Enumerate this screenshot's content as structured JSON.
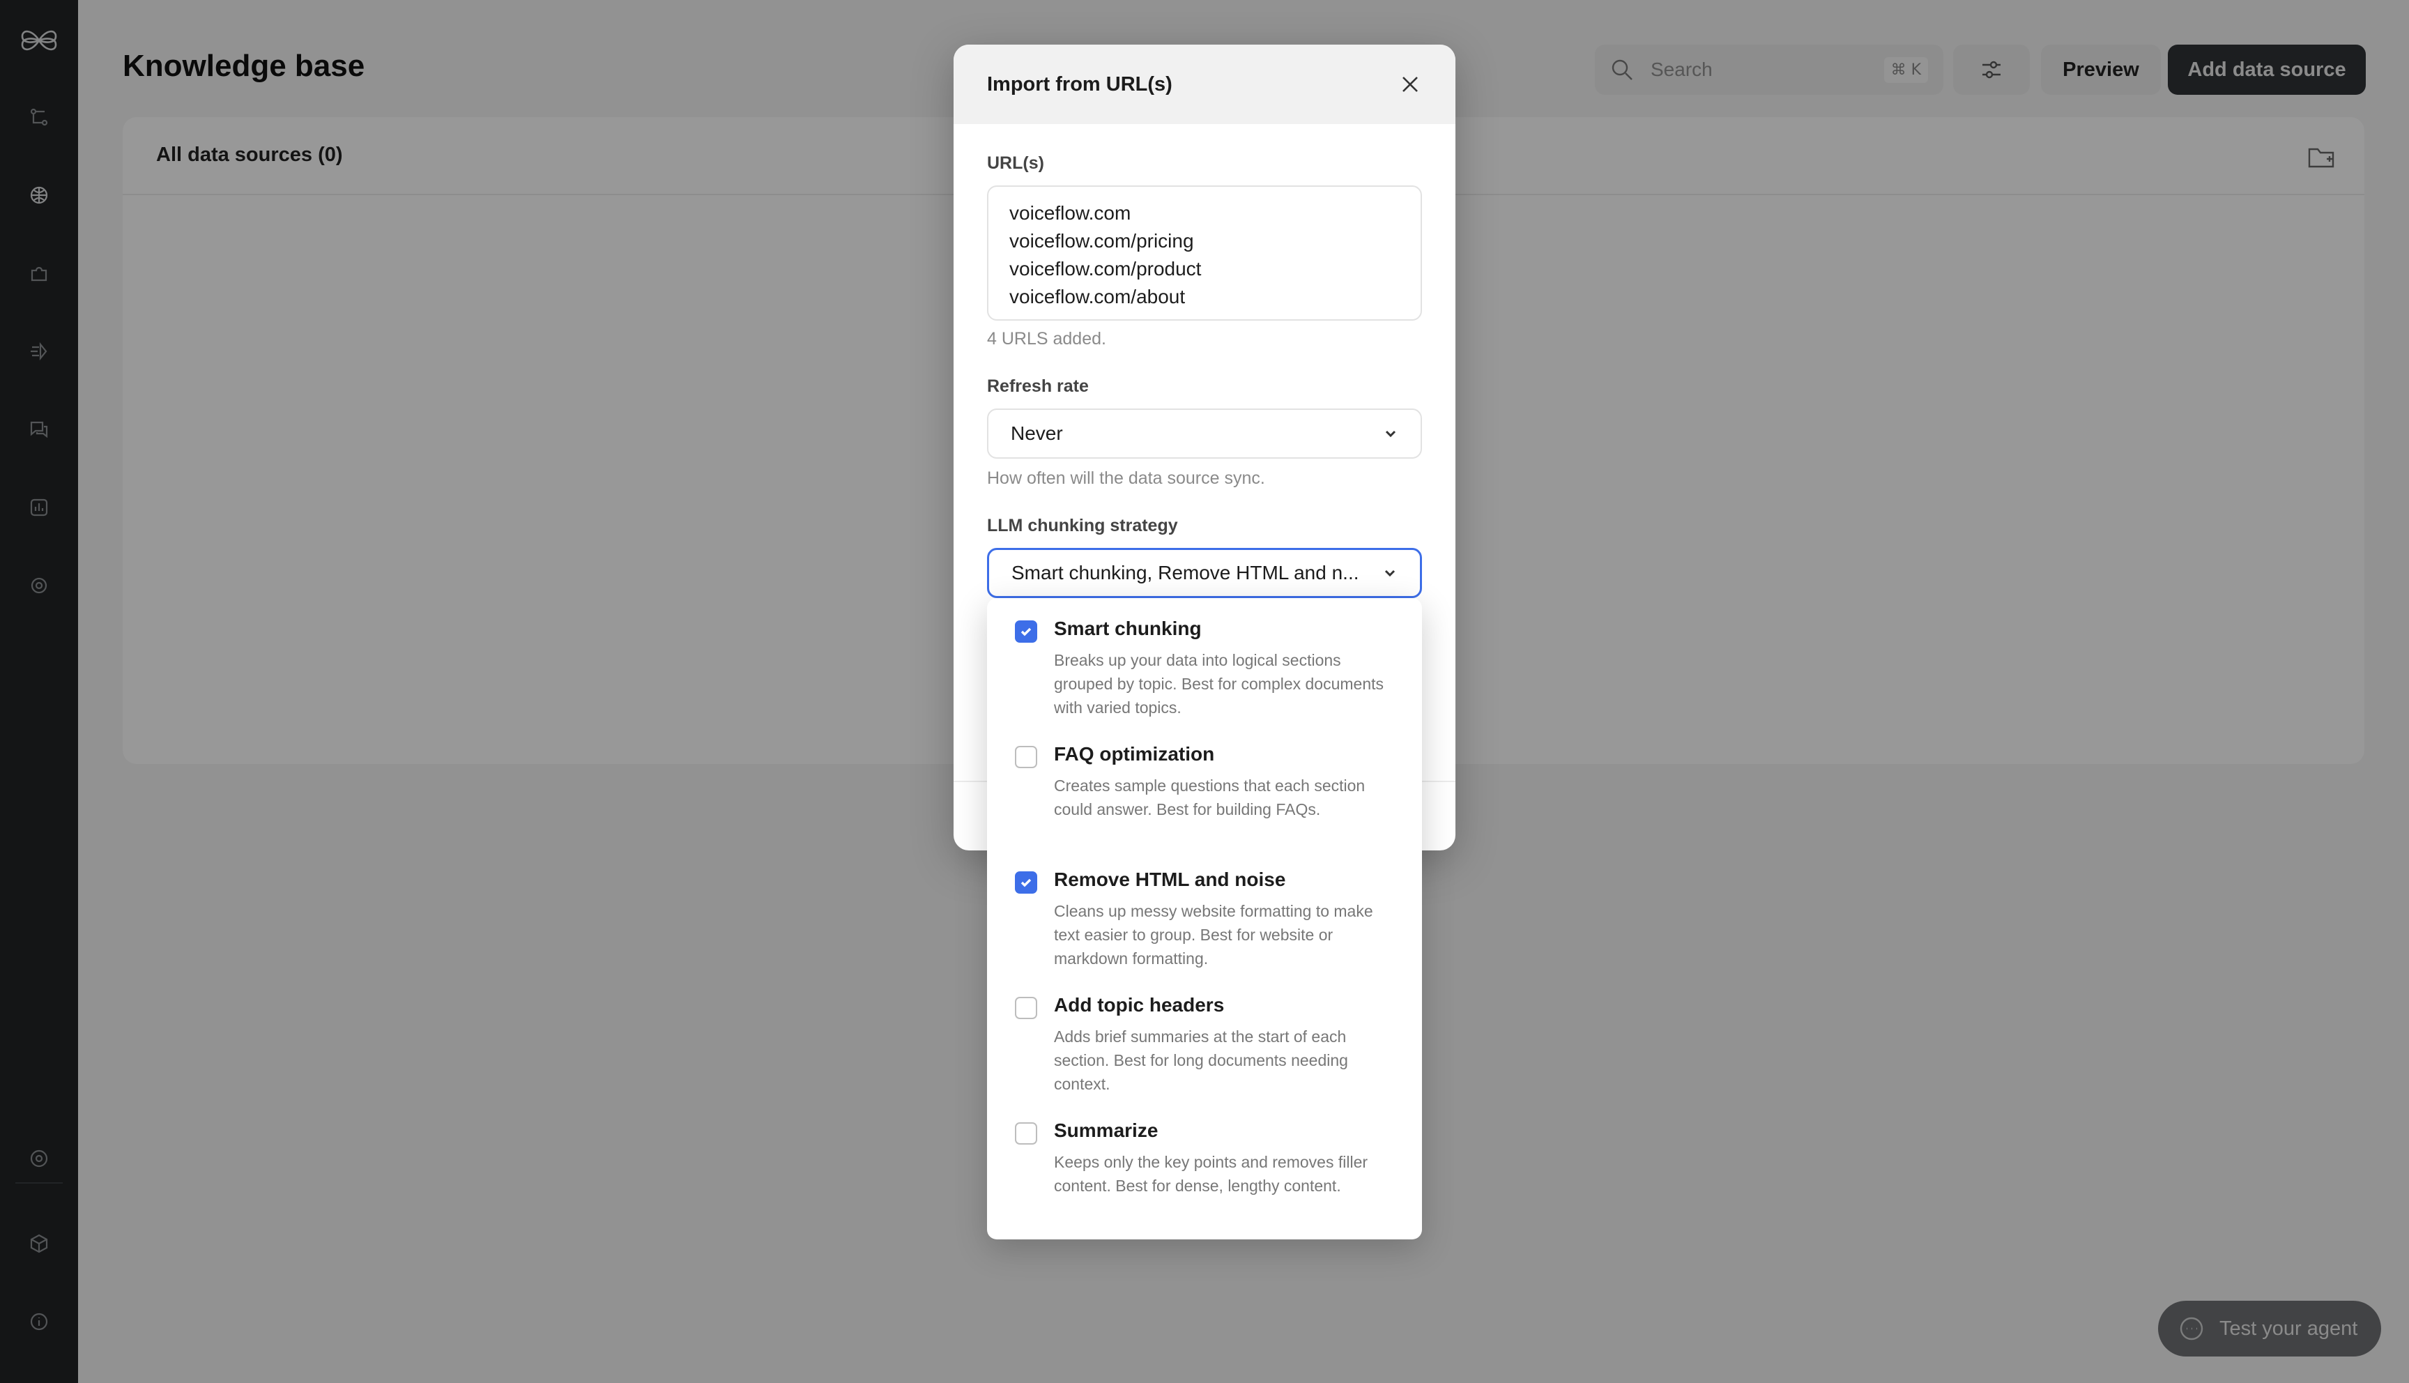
{
  "page": {
    "title": "Knowledge base",
    "search_placeholder": "Search",
    "search_shortcut": "⌘ K",
    "preview_label": "Preview",
    "add_source_label": "Add data source",
    "panel_title": "All data sources (0)",
    "test_agent_label": "Test your agent"
  },
  "sidebar": {
    "icons": [
      "logo-icon",
      "workflow-icon",
      "knowledge-icon",
      "puzzle-icon",
      "agent-icon",
      "conversations-icon",
      "analytics-icon",
      "settings-icon",
      "help-circle-icon",
      "cube-icon",
      "info-icon"
    ]
  },
  "modal": {
    "title": "Import from URL(s)",
    "urls_label": "URL(s)",
    "urls": [
      "voiceflow.com",
      "voiceflow.com/pricing",
      "voiceflow.com/product",
      "voiceflow.com/about"
    ],
    "urls_count_hint": "4 URLS added.",
    "refresh_label": "Refresh rate",
    "refresh_value": "Never",
    "refresh_hint": "How often will the data source sync.",
    "chunking_label": "LLM chunking strategy",
    "chunking_value": "Smart chunking, Remove HTML and n..."
  },
  "chunking_options": [
    {
      "label": "Smart chunking",
      "desc": "Breaks up your data into logical sections grouped by topic. Best for complex documents with varied topics.",
      "checked": true
    },
    {
      "label": "FAQ optimization",
      "desc": "Creates sample questions that each section could answer. Best for building FAQs.",
      "checked": false
    },
    {
      "label": "Remove HTML and noise",
      "desc": "Cleans up messy website formatting to make text easier to group. Best for website or markdown formatting.",
      "checked": true
    },
    {
      "label": "Add topic headers",
      "desc": "Adds brief summaries at the start of each section. Best for long documents needing context.",
      "checked": false
    },
    {
      "label": "Summarize",
      "desc": "Keeps only the key points and removes filler content. Best for dense, lengthy content.",
      "checked": false
    }
  ],
  "colors": {
    "accent": "#3d6ee8",
    "sidebar_bg": "#222426",
    "overlay": "rgba(0,0,0,0.40)"
  }
}
